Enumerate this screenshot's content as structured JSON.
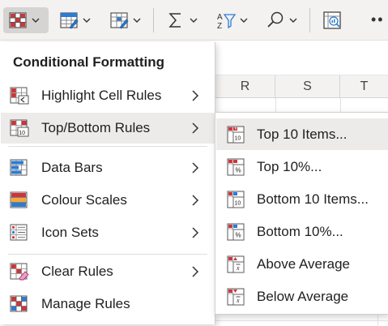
{
  "toolbar": {
    "buttons": [
      {
        "name": "conditional-formatting",
        "icon": "conditional-formatting-icon"
      },
      {
        "name": "format-as-table",
        "icon": "format-as-table-icon"
      },
      {
        "name": "cell-styles",
        "icon": "cell-styles-icon"
      },
      {
        "name": "autosum",
        "icon": "sigma-icon"
      },
      {
        "name": "sort-filter",
        "icon": "sort-filter-icon"
      },
      {
        "name": "find-select",
        "icon": "search-icon"
      },
      {
        "name": "analyze-data",
        "icon": "analyze-data-icon"
      }
    ],
    "more": "••"
  },
  "sheet": {
    "columns": [
      "R",
      "S",
      "T"
    ]
  },
  "menu": {
    "title": "Conditional Formatting",
    "items": [
      {
        "label": "Highlight Cell Rules",
        "icon": "highlight-cell-rules-icon",
        "submenu": true
      },
      {
        "label": "Top/Bottom Rules",
        "icon": "top-bottom-rules-icon",
        "submenu": true,
        "active": true
      },
      {
        "label": "Data Bars",
        "icon": "data-bars-icon",
        "submenu": true
      },
      {
        "label": "Colour Scales",
        "icon": "colour-scales-icon",
        "submenu": true
      },
      {
        "label": "Icon Sets",
        "icon": "icon-sets-icon",
        "submenu": true
      },
      {
        "label": "Clear Rules",
        "icon": "clear-rules-icon",
        "submenu": true
      },
      {
        "label": "Manage Rules",
        "icon": "manage-rules-icon",
        "submenu": false
      }
    ]
  },
  "submenu": {
    "items": [
      {
        "label": "Top 10 Items...",
        "icon": "top-10-items-icon",
        "hover": true
      },
      {
        "label": "Top 10%...",
        "icon": "top-10-percent-icon"
      },
      {
        "label": "Bottom 10 Items...",
        "icon": "bottom-10-items-icon"
      },
      {
        "label": "Bottom 10%...",
        "icon": "bottom-10-percent-icon"
      },
      {
        "label": "Above Average",
        "icon": "above-average-icon"
      },
      {
        "label": "Below Average",
        "icon": "below-average-icon"
      }
    ]
  },
  "colors": {
    "accent_blue": "#2b7cd3",
    "accent_red": "#d13438",
    "menu_hover": "#edebe9",
    "toolbar_bg": "#f3f2f1"
  }
}
